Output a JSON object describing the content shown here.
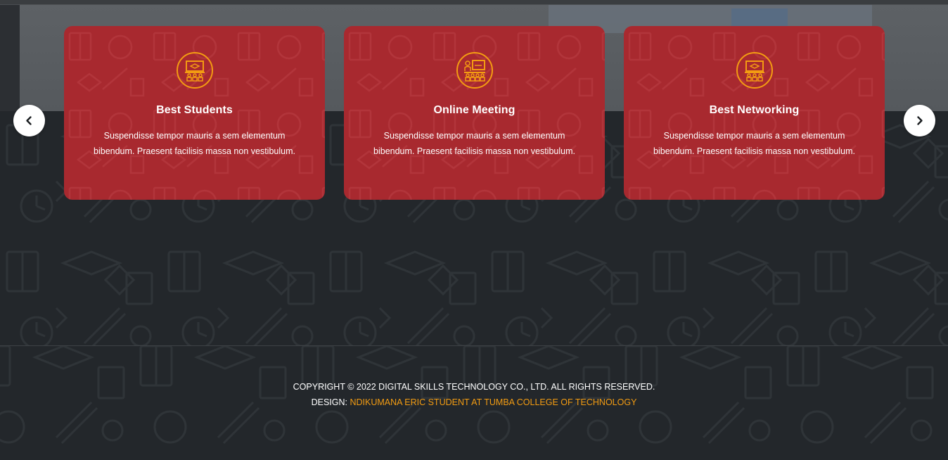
{
  "slider": {
    "prev_icon": "chevron-left-icon",
    "next_icon": "chevron-right-icon",
    "cards": [
      {
        "icon": "classroom-presentation-icon",
        "title": "Best Students",
        "description": "Suspendisse tempor mauris a sem elementum bibendum. Praesent facilisis massa non vestibulum."
      },
      {
        "icon": "online-meeting-icon",
        "title": "Online Meeting",
        "description": "Suspendisse tempor mauris a sem elementum bibendum. Praesent facilisis massa non vestibulum."
      },
      {
        "icon": "classroom-presentation-icon",
        "title": "Best Networking",
        "description": "Suspendisse tempor mauris a sem elementum bibendum. Praesent facilisis massa non vestibulum."
      }
    ]
  },
  "footer": {
    "copyright": "COPYRIGHT © 2022 DIGITAL SKILLS TECHNOLOGY CO., LTD. ALL RIGHTS RESERVED.",
    "design_label": "DESIGN:",
    "design_credit": "NDIKUMANA ERIC STUDENT AT TUMBA COLLEGE OF TECHNOLOGY"
  },
  "colors": {
    "card_bg": "#a8292f",
    "accent": "#f39c12",
    "dark_bg": "#23272b"
  }
}
